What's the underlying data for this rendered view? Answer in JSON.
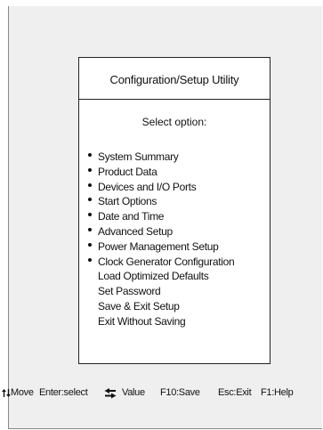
{
  "dialog": {
    "title": "Configuration/Setup Utility",
    "prompt": "Select  option:"
  },
  "menu": {
    "items": [
      {
        "label": "System Summary",
        "bullet": true
      },
      {
        "label": "Product Data",
        "bullet": true
      },
      {
        "label": "Devices and I/O Ports",
        "bullet": true
      },
      {
        "label": "Start Options",
        "bullet": true
      },
      {
        "label": "Date and Time",
        "bullet": true
      },
      {
        "label": "Advanced Setup",
        "bullet": true
      },
      {
        "label": "Power Management Setup",
        "bullet": true
      },
      {
        "label": "Clock Generator Configuration",
        "bullet": true
      },
      {
        "label": "Load Optimized Defaults",
        "bullet": false
      },
      {
        "label": "Set Password",
        "bullet": false
      },
      {
        "label": "Save & Exit Setup",
        "bullet": false
      },
      {
        "label": "Exit Without Saving",
        "bullet": false
      }
    ]
  },
  "footer": {
    "move_label": "Move",
    "enter_label": "Enter:select",
    "value_label": "Value",
    "f10_label": "F10:Save",
    "esc_label": "Esc:Exit",
    "f1_label": "F1:Help",
    "move_icon": "up-down-arrows-icon",
    "value_icon": "left-right-arrows-icon"
  }
}
